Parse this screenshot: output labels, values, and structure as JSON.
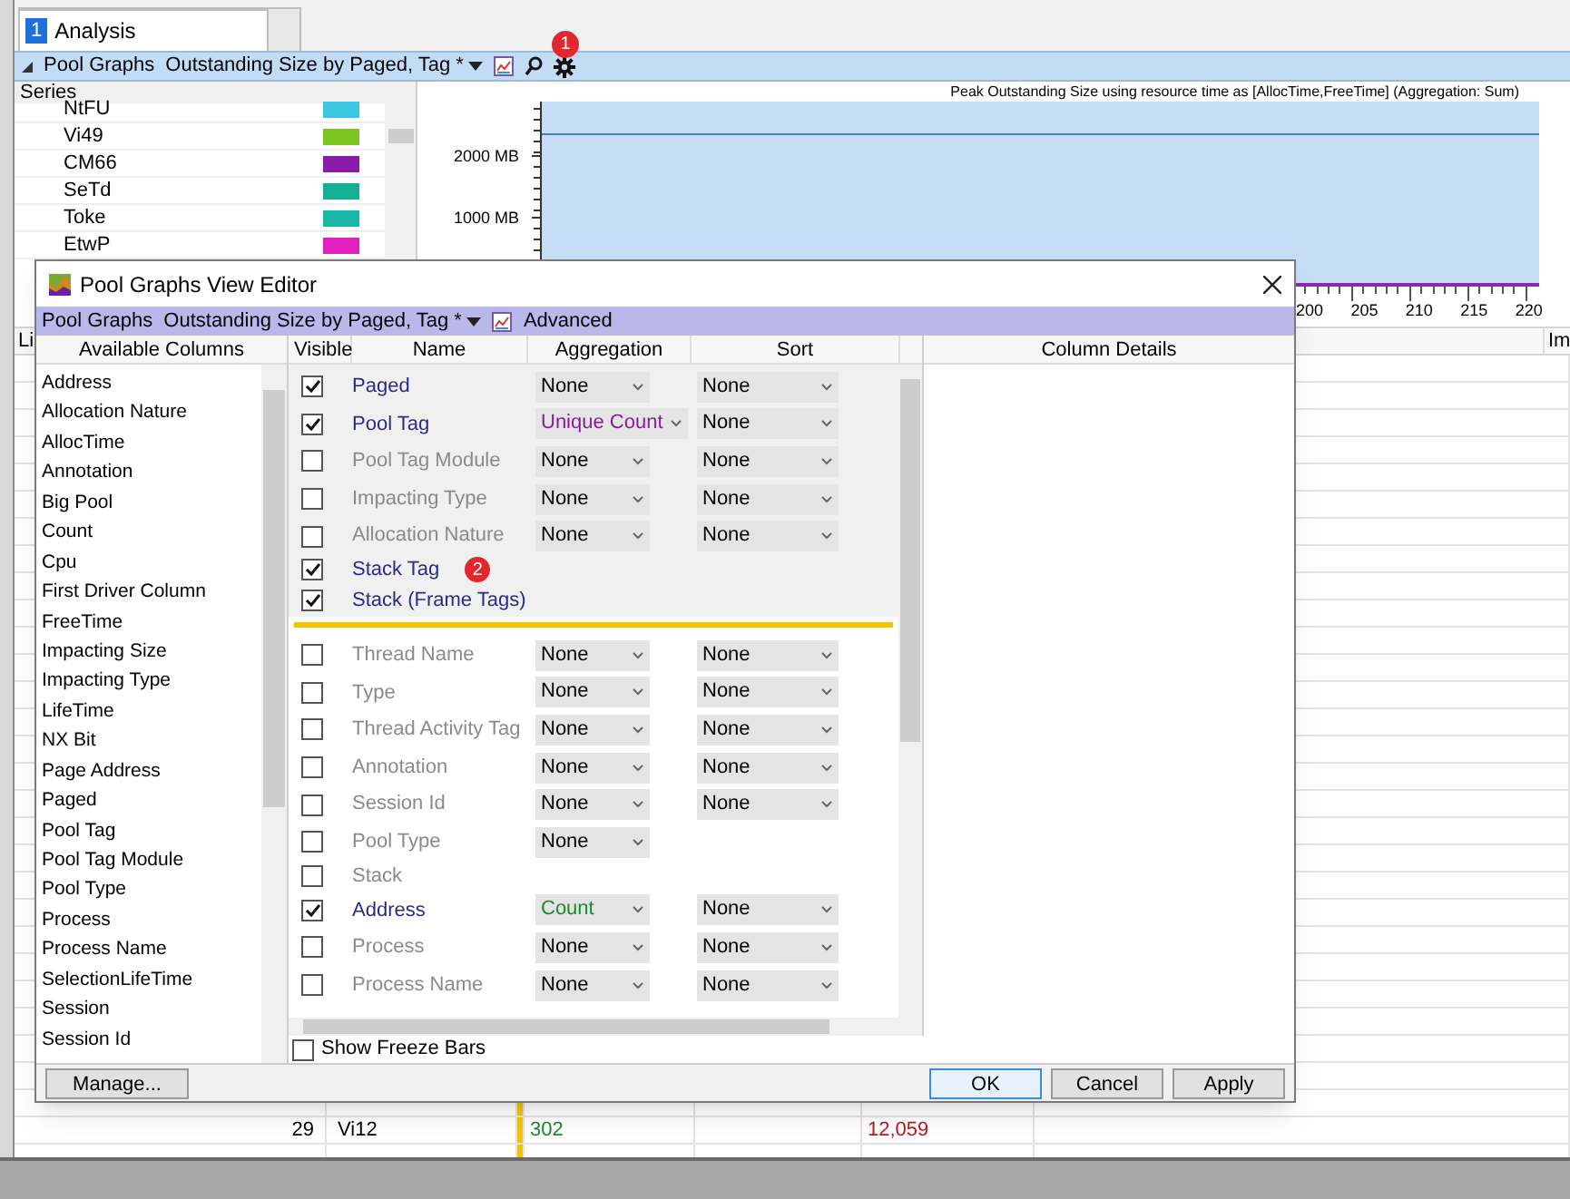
{
  "document_tab": {
    "number": "1",
    "label": "Analysis",
    "selected": true
  },
  "graph_header": {
    "title": "Pool Graphs",
    "preset": "Outstanding Size by Paged, Tag *",
    "annotation_badge": "1"
  },
  "series_panel": {
    "header": "Series",
    "items": [
      {
        "name": "NtFU",
        "color": "#3cc8e0"
      },
      {
        "name": "Vi49",
        "color": "#7cc520"
      },
      {
        "name": "CM66",
        "color": "#8a1aa8"
      },
      {
        "name": "SeTd",
        "color": "#14b092"
      },
      {
        "name": "Toke",
        "color": "#18b8a8"
      },
      {
        "name": "EtwP",
        "color": "#e020c0"
      }
    ]
  },
  "chart": {
    "title": "Peak Outstanding Size using resource time as [AllocTime,FreeTime] (Aggregation: Sum)",
    "y_axis_labels": [
      "2000 MB",
      "1000 MB"
    ],
    "x_axis_labels": [
      "200",
      "205",
      "210",
      "215",
      "220"
    ]
  },
  "table": {
    "columns": [
      "Li",
      "Im"
    ],
    "rows": [
      {
        "cells": [
          "29",
          "Vi12",
          "302",
          "12,059"
        ]
      }
    ]
  },
  "dialog": {
    "title": "Pool Graphs View Editor",
    "toolbar": {
      "title": "Pool Graphs",
      "preset": "Outstanding Size by Paged, Tag *",
      "advanced": "Advanced"
    },
    "available_columns": {
      "header": "Available Columns",
      "items": [
        "Address",
        "Allocation Nature",
        "AllocTime",
        "Annotation",
        "Big Pool",
        "Count",
        "Cpu",
        "First Driver Column",
        "FreeTime",
        "Impacting Size",
        "Impacting Type",
        "LifeTime",
        "NX Bit",
        "Page Address",
        "Paged",
        "Pool Tag",
        "Pool Tag Module",
        "Pool Type",
        "Process",
        "Process Name",
        "SelectionLifeTime",
        "Session",
        "Session Id"
      ]
    },
    "grid": {
      "columns": [
        "Visible",
        "Name",
        "Aggregation",
        "Sort"
      ],
      "groups": [
        {
          "rows": [
            {
              "name": "Paged",
              "visible": true,
              "aggregation": {
                "value": "None",
                "color": "#000000"
              },
              "sort": "None"
            },
            {
              "name": "Pool Tag",
              "visible": true,
              "aggregation": {
                "value": "Unique Count",
                "color": "#8b1a9b"
              },
              "sort": "None"
            },
            {
              "name": "Pool Tag Module",
              "visible": false,
              "aggregation": {
                "value": "None",
                "color": "#000000"
              },
              "sort": "None"
            },
            {
              "name": "Impacting Type",
              "visible": false,
              "aggregation": {
                "value": "None",
                "color": "#000000"
              },
              "sort": "None"
            },
            {
              "name": "Allocation Nature",
              "visible": false,
              "aggregation": {
                "value": "None",
                "color": "#000000"
              },
              "sort": "None"
            },
            {
              "name": "Stack Tag",
              "visible": true,
              "badge": "2"
            },
            {
              "name": "Stack (Frame Tags)",
              "visible": true
            }
          ]
        },
        {
          "rows": [
            {
              "name": "Thread Name",
              "visible": false,
              "aggregation": {
                "value": "None",
                "color": "#000000"
              },
              "sort": "None"
            },
            {
              "name": "Type",
              "visible": false,
              "aggregation": {
                "value": "None",
                "color": "#000000"
              },
              "sort": "None"
            },
            {
              "name": "Thread Activity Tag",
              "visible": false,
              "aggregation": {
                "value": "None",
                "color": "#000000"
              },
              "sort": "None"
            },
            {
              "name": "Annotation",
              "visible": false,
              "aggregation": {
                "value": "None",
                "color": "#000000"
              },
              "sort": "None"
            },
            {
              "name": "Session Id",
              "visible": false,
              "aggregation": {
                "value": "None",
                "color": "#000000"
              },
              "sort": "None"
            },
            {
              "name": "Pool Type",
              "visible": false,
              "aggregation": {
                "value": "None",
                "color": "#000000"
              }
            },
            {
              "name": "Stack",
              "visible": false
            },
            {
              "name": "Address",
              "visible": true,
              "aggregation": {
                "value": "Count",
                "color": "#1a8a2a"
              },
              "sort": "None"
            },
            {
              "name": "Process",
              "visible": false,
              "aggregation": {
                "value": "None",
                "color": "#000000"
              },
              "sort": "None"
            },
            {
              "name": "Process Name",
              "visible": false,
              "aggregation": {
                "value": "None",
                "color": "#000000"
              },
              "sort": "None"
            }
          ]
        }
      ]
    },
    "details_header": "Column Details",
    "show_freeze_bars": {
      "label": "Show Freeze Bars",
      "checked": false
    },
    "buttons": [
      "Manage...",
      "OK",
      "Cancel",
      "Apply"
    ]
  }
}
